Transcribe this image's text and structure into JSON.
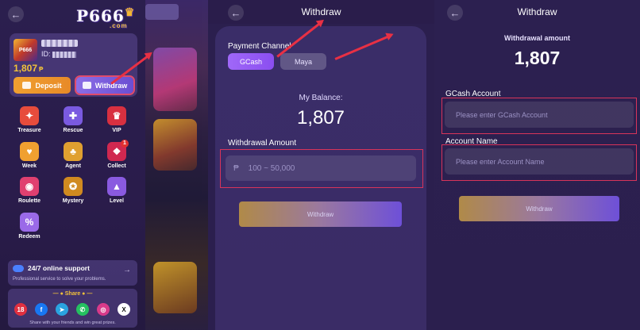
{
  "panel1": {
    "logo": "P666",
    "logo_suffix": ".com",
    "user_id_label": "ID:",
    "balance": "1,807",
    "currency": "₱",
    "deposit_label": "Deposit",
    "withdraw_label": "Withdraw",
    "menu": [
      {
        "label": "Treasure",
        "icon": "treasure-icon",
        "color": "#e74c3c"
      },
      {
        "label": "Rescue",
        "icon": "rescue-icon",
        "color": "#7a5ae0"
      },
      {
        "label": "VIP",
        "icon": "vip-icon",
        "color": "#d83040"
      },
      {
        "label": "Week",
        "icon": "week-icon",
        "color": "#f0a030"
      },
      {
        "label": "Agent",
        "icon": "agent-icon",
        "color": "#e0a030"
      },
      {
        "label": "Collect",
        "icon": "collect-icon",
        "color": "#d02850",
        "badge": "1"
      },
      {
        "label": "Roulette",
        "icon": "roulette-icon",
        "color": "#e04070"
      },
      {
        "label": "Mystery",
        "icon": "mystery-icon",
        "color": "#d08a20"
      },
      {
        "label": "Level",
        "icon": "level-icon",
        "color": "#8a5ae0"
      },
      {
        "label": "Redeem",
        "icon": "redeem-icon",
        "color": "#9a6ae8"
      }
    ],
    "support_title": "24/7 online support",
    "support_subtitle": "Professional service to solve your problems.",
    "share_title": "Share",
    "share_footer": "Share with your friends and win great prizes.",
    "share_icons": [
      {
        "name": "age-18-icon",
        "glyph": "18",
        "color": "#e03040"
      },
      {
        "name": "facebook-icon",
        "glyph": "f",
        "color": "#1877f2"
      },
      {
        "name": "telegram-icon",
        "glyph": "➤",
        "color": "#2aa3e0"
      },
      {
        "name": "whatsapp-icon",
        "glyph": "✆",
        "color": "#25c060"
      },
      {
        "name": "instagram-icon",
        "glyph": "◎",
        "color": "#d83a8a"
      },
      {
        "name": "x-icon",
        "glyph": "X",
        "color": "#111111"
      }
    ]
  },
  "panel2": {
    "title": "Withdraw",
    "payment_channel_label": "Payment Channel",
    "channels": [
      "GCash",
      "Maya"
    ],
    "balance_label": "My Balance:",
    "balance": "1,807",
    "amount_label": "Withdrawal Amount",
    "currency": "₱",
    "amount_placeholder": "100 ~ 50,000",
    "withdraw_button": "Withdraw"
  },
  "panel3": {
    "title": "Withdraw",
    "amount_label": "Withdrawal amount",
    "amount": "1,807",
    "account_label": "GCash Account",
    "account_placeholder": "Please enter GCash Account",
    "name_label": "Account Name",
    "name_placeholder": "Please enter Account Name",
    "withdraw_button": "Withdraw"
  },
  "colors": {
    "accent": "#8a4ef0",
    "highlight": "#d8345a",
    "gold": "#f2c23a"
  }
}
